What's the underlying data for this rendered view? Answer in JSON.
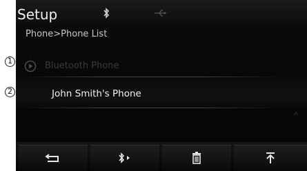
{
  "header": {
    "title": "Setup",
    "status_icons": [
      "bluetooth-icon",
      "usb-icon"
    ]
  },
  "breadcrumb": "Phone>Phone List",
  "list": {
    "items": [
      {
        "label": "Bluetooth Phone",
        "icon": "play-circle-icon",
        "state": "disabled"
      },
      {
        "label": "John Smith's Phone",
        "state": "normal"
      }
    ]
  },
  "toolbar": {
    "buttons": [
      {
        "icon": "back-icon"
      },
      {
        "icon": "bluetooth-connect-icon"
      },
      {
        "icon": "trash-icon"
      },
      {
        "icon": "move-to-top-icon"
      }
    ]
  },
  "callouts": [
    "1",
    "2"
  ],
  "colors": {
    "background": "#050505",
    "text_primary": "#f0f0f0",
    "text_disabled": "#3a3a3a"
  }
}
